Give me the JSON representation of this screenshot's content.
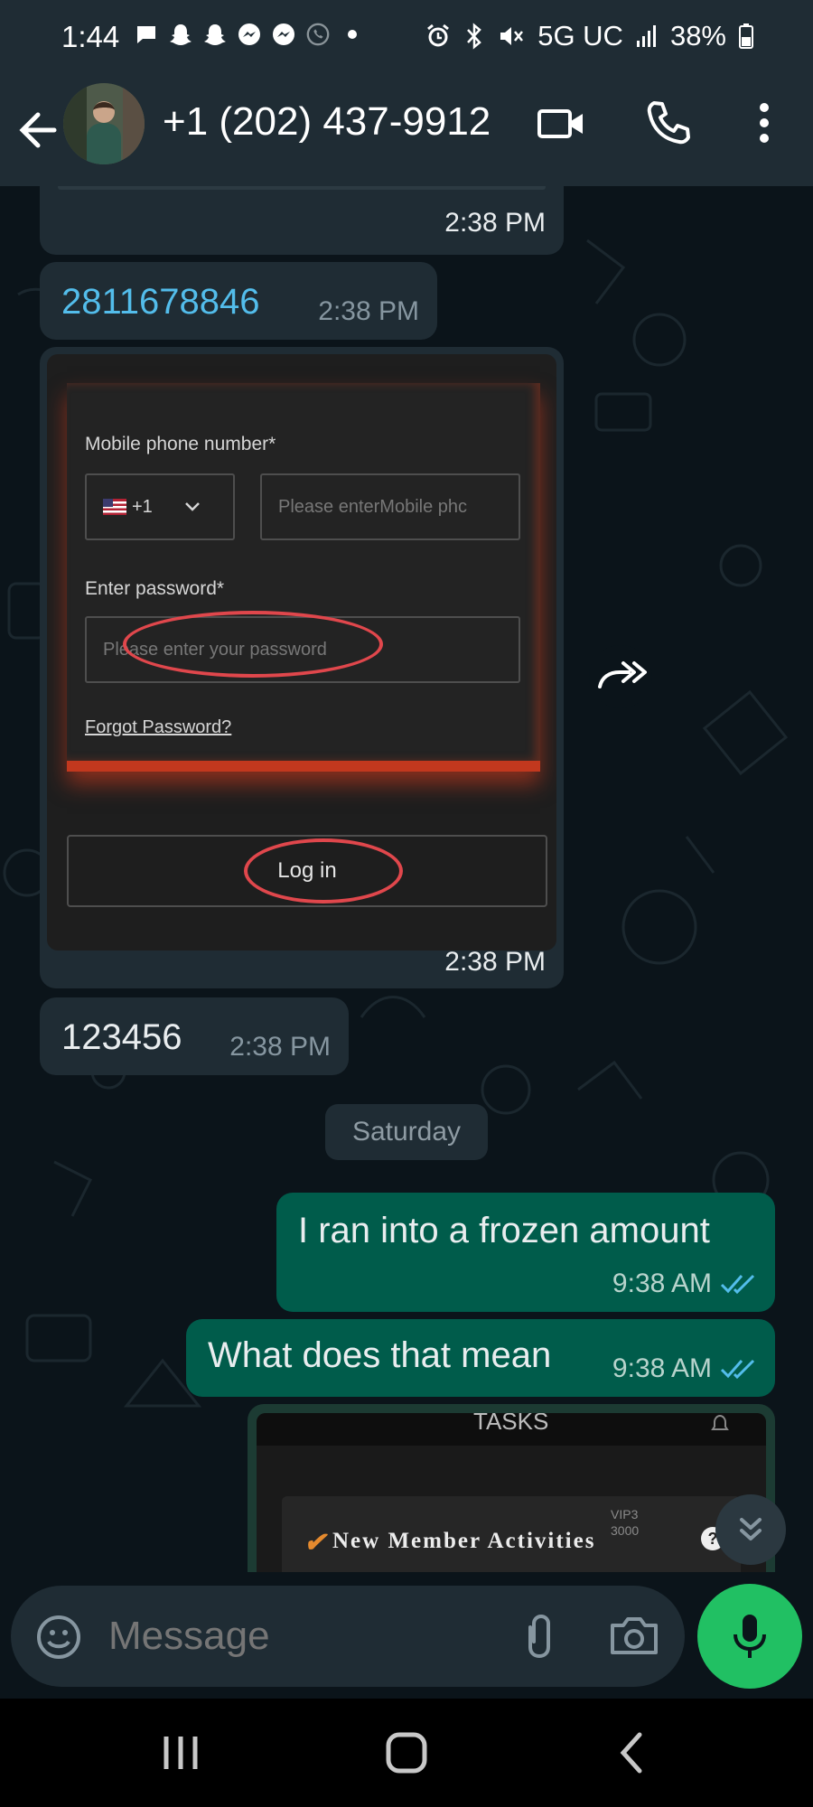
{
  "status_bar": {
    "time": "1:44",
    "network": "5G UC",
    "battery": "38%"
  },
  "header": {
    "contact_name": "+1 (202) 437-9912"
  },
  "messages": [
    {
      "text": "",
      "time": "2:38 PM"
    },
    {
      "text": "2811678846",
      "time": "2:38 PM",
      "link_color": "#53bdeb"
    },
    {
      "time": "2:38 PM",
      "screenshot": {
        "mobile_label": "Mobile phone number*",
        "country_code": "+1",
        "mobile_placeholder": "Please enterMobile phc",
        "password_label": "Enter password*",
        "password_placeholder": "Please enter your password",
        "forgot_link": "Forgot Password?",
        "login_button": "Log in"
      }
    },
    {
      "text": "123456",
      "time": "2:38 PM"
    },
    {
      "day_separator": "Saturday"
    },
    {
      "text": "I ran into a frozen amount",
      "time": "9:38 AM",
      "outgoing": true
    },
    {
      "text": "What does that mean",
      "time": "9:38 AM",
      "outgoing": true
    },
    {
      "outgoing": true,
      "screenshot": {
        "top_label": "TASKS",
        "vip_label": "VIP3",
        "vip_amount": "3000",
        "activity_title": "New Member Activities"
      }
    }
  ],
  "composer": {
    "placeholder": "Message"
  },
  "colors": {
    "bg": "#0b141a",
    "bar": "#1f2c34",
    "incoming": "#1f2c34",
    "outgoing": "#005c4b",
    "accent_green": "#21c063",
    "tick_blue": "#53bdeb"
  }
}
